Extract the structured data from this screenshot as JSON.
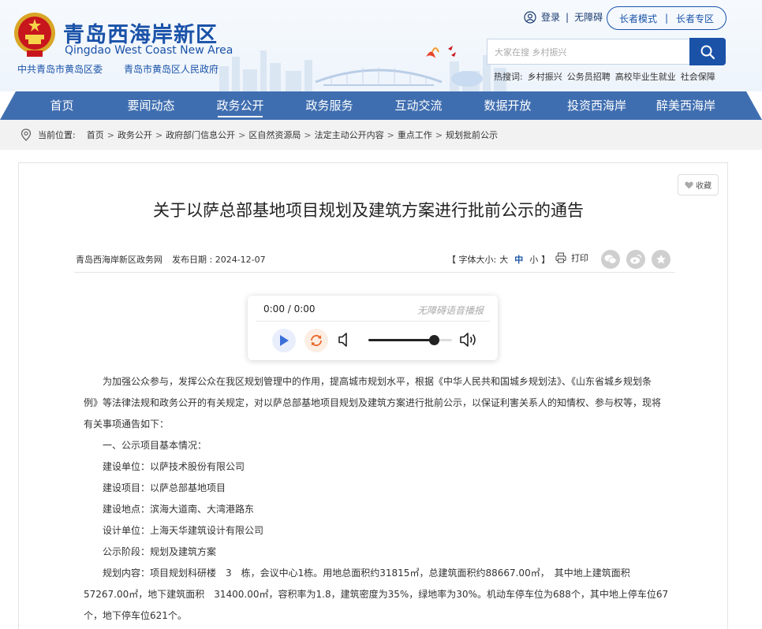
{
  "header": {
    "site_name": "青岛西海岸新区",
    "site_sub": "Qingdao West Coast New Area",
    "org1": "中共青岛市黄岛区委",
    "org2": "青岛市黄岛区人民政府",
    "login": "登录",
    "accessible": "无障碍",
    "elder_mode": "长者模式",
    "elder_zone": "长者专区",
    "search_placeholder": "大家在搜 乡村振兴",
    "hot_label": "热搜词:",
    "hot_words": [
      "乡村振兴",
      "公务员招聘",
      "高校毕业生就业",
      "社会保障"
    ]
  },
  "nav": {
    "items": [
      "首页",
      "要闻动态",
      "政务公开",
      "政务服务",
      "互动交流",
      "数据开放",
      "投资西海岸",
      "醉美西海岸"
    ],
    "active_index": 2
  },
  "breadcrumb": {
    "label": "当前位置:",
    "items": [
      "首页",
      "政务公开",
      "政府部门信息公开",
      "区自然资源局",
      "法定主动公开内容",
      "重点工作",
      "规划批前公示"
    ]
  },
  "article": {
    "favorite": "收藏",
    "title": "关于以萨总部基地项目规划及建筑方案进行批前公示的通告",
    "source": "青岛西海岸新区政务网",
    "date": "发布日期 : 2024-12-07",
    "fontsize_open": "【 字体大小:",
    "fontsize_large": "大",
    "fontsize_mid": "中",
    "fontsize_small": "小",
    "fontsize_close": "】",
    "print": "打印",
    "player_time": "0:00 / 0:00",
    "player_tag": "无障碍语音播报",
    "player_volume": 0.78,
    "paragraphs": [
      "为加强公众参与，发挥公众在我区规划管理中的作用，提高城市规划水平，根据《中华人民共和国城乡规划法》、《山东省城乡规划条",
      "例》等法律法规和政务公开的有关规定，对以萨总部基地项目规划及建筑方案进行批前公示，以保证利害关系人的知情权、参与权等，现将",
      "有关事项通告如下：",
      "一、公示项目基本情况：",
      "建设单位：以萨技术股份有限公司",
      "建设项目：以萨总部基地项目",
      "建设地点：滨海大道南、大湾港路东",
      "设计单位：上海天华建筑设计有限公司",
      "公示阶段：规划及建筑方案",
      "规划内容：项目规划科研楼　3　栋，会议中心1栋。用地总面积约31815㎡，总建筑面积约88667.00㎡，　其中地上建筑面积",
      "57267.00㎡，地下建筑面积　31400.00㎡，容积率为1.8，建筑密度为35%，绿地率为30%。机动车停车位为688个，其中地上停车位67",
      "个，地下停车位621个。"
    ]
  },
  "colors": {
    "brand": "#1a52a8",
    "nav": "#3f6eb0",
    "breadcrumb_bg": "#f2f2f2"
  }
}
